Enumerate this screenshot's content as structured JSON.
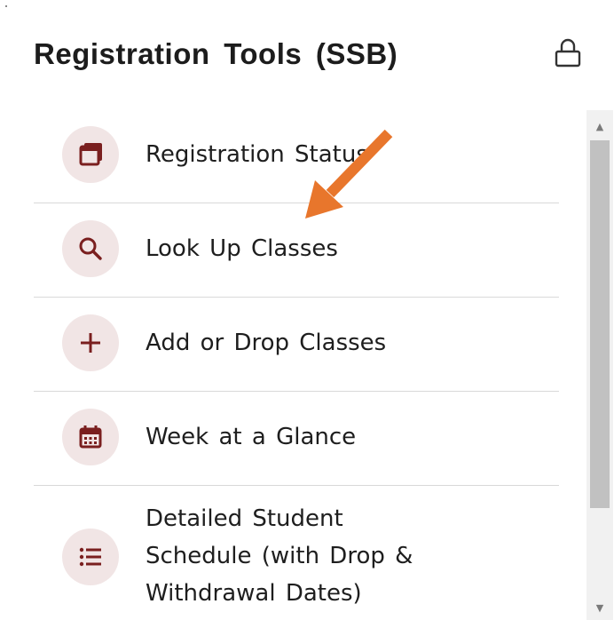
{
  "panel": {
    "title": "Registration Tools (SSB)",
    "lock_icon": "lock-icon"
  },
  "items": [
    {
      "label": "Registration Status",
      "icon": "windows-icon"
    },
    {
      "label": "Look Up Classes",
      "icon": "search-icon"
    },
    {
      "label": "Add or Drop Classes",
      "icon": "plus-icon"
    },
    {
      "label": "Week at a Glance",
      "icon": "calendar-icon"
    },
    {
      "label_lines": [
        "Detailed Student",
        "Schedule (with Drop &",
        "Withdrawal Dates)"
      ],
      "icon": "list-icon"
    }
  ],
  "scrollbar": {
    "up": "▲",
    "down": "▼"
  },
  "colors": {
    "accent": "#7a1f1f",
    "icon_bg": "#f1e5e5",
    "arrow": "#e8762c",
    "divider": "#d9d9d9"
  }
}
